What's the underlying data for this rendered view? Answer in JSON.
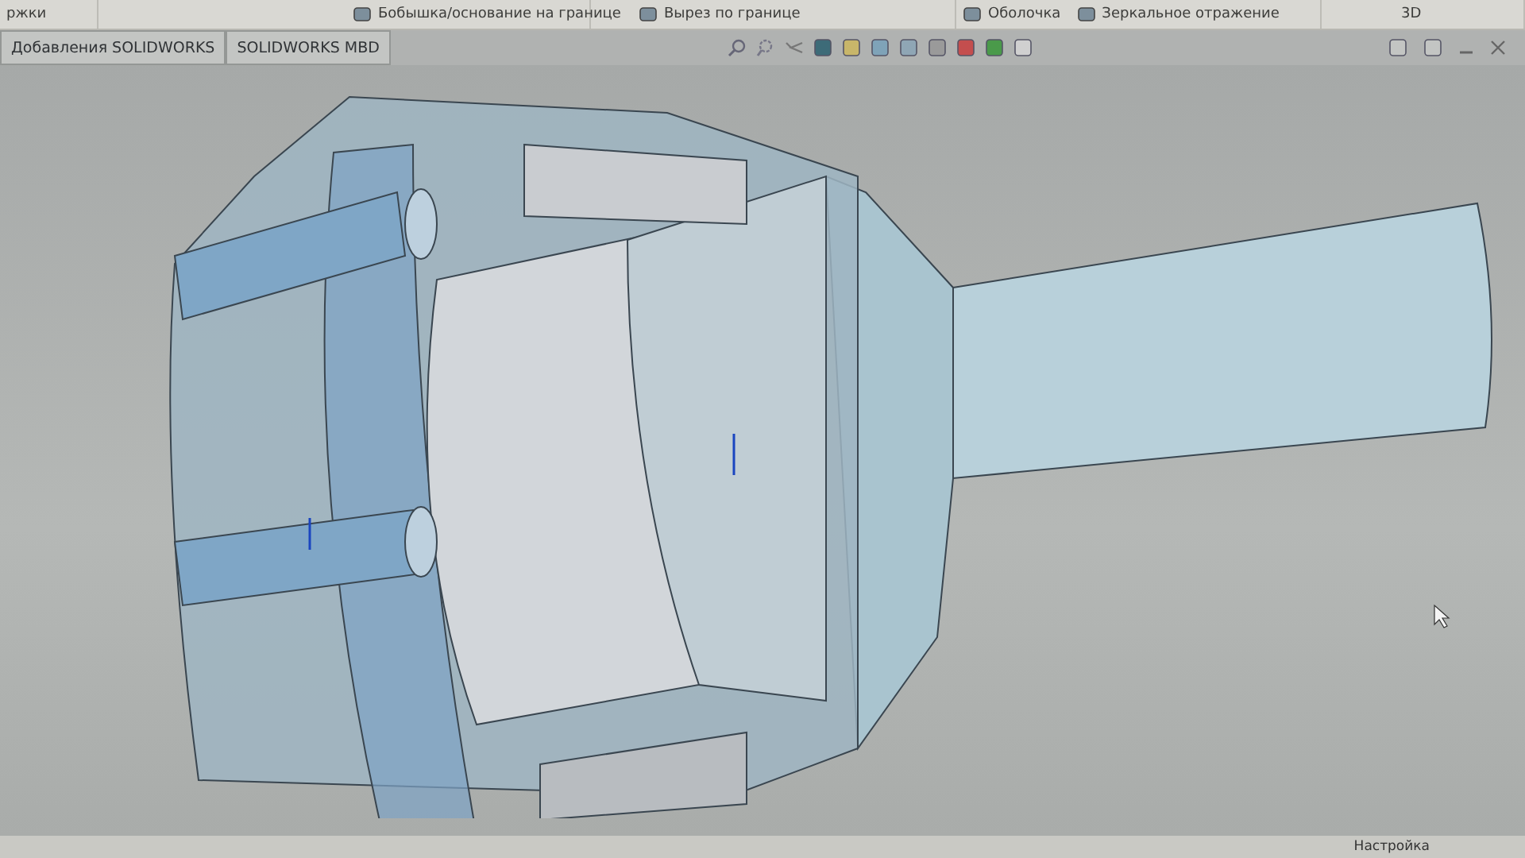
{
  "ribbon": {
    "groups": [
      {
        "items": [
          "ржки"
        ]
      },
      {
        "items": [
          "Бобышка/основание на границе"
        ]
      },
      {
        "items": [
          "Вырез по границе"
        ]
      },
      {
        "items": [
          "Оболочка",
          "Зеркальное отражение"
        ]
      },
      {
        "items": [
          "3D"
        ]
      }
    ]
  },
  "tabs": [
    {
      "label": "Добавления SOLIDWORKS",
      "selected": false
    },
    {
      "label": "SOLIDWORKS MBD",
      "selected": false
    }
  ],
  "status_bar": {
    "label": "Настройка"
  }
}
